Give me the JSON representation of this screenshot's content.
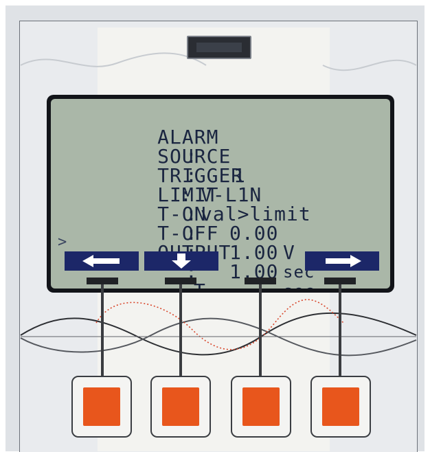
{
  "device": {
    "accent_color": "#e8561c",
    "lcd_background": "#aab7a8",
    "lcd_text_color": "#1a2540"
  },
  "screen": {
    "rows": [
      {
        "label": "ALARM",
        "sep": ":",
        "value": "1",
        "unit": ""
      },
      {
        "label": "SOURCE",
        "sep": ":",
        "value": "V-L1N",
        "unit": ""
      },
      {
        "label": "TRIGGER",
        "sep": ":",
        "value": "val>limit",
        "unit": ""
      },
      {
        "label": "LIMIT",
        "sep": ":",
        "value": "0.00",
        "unit": "V"
      },
      {
        "label": "T-ON",
        "sep": ":",
        "value": "1.00",
        "unit": "sec"
      },
      {
        "label": "T-OFF",
        "sep": ":",
        "value": "1.00",
        "unit": "sec"
      },
      {
        "label": "OUTPUT",
        "sep": ":",
        "value": "T",
        "unit": ""
      }
    ],
    "cursor": ">"
  },
  "softkeys": [
    {
      "icon": "arrow-left-icon"
    },
    {
      "icon": "arrow-down-icon"
    },
    {
      "icon": "blank"
    },
    {
      "icon": "arrow-right-icon"
    }
  ]
}
